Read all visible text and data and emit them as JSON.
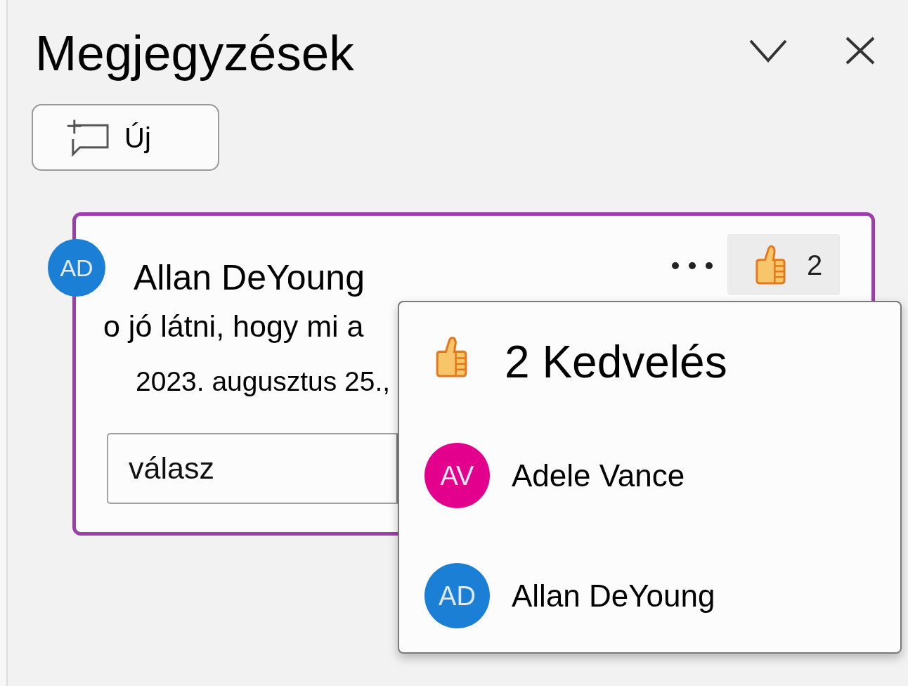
{
  "pane": {
    "title": "Megjegyzések"
  },
  "new_button": {
    "label": "Új"
  },
  "comment": {
    "selected": true,
    "author": {
      "initials": "AD",
      "name": "Allan DeYoung"
    },
    "text": "o jó látni, hogy mi a",
    "date": "2023. augusztus 25.,",
    "likes": {
      "count": "2"
    },
    "reply": {
      "placeholder": "válasz"
    }
  },
  "likes_popup": {
    "title": "2 Kedvelés",
    "people": [
      {
        "initials": "AV",
        "name": "Adele Vance",
        "color": "#e3008c"
      },
      {
        "initials": "AD",
        "name": "Allan DeYoung",
        "color": "#1b7fd6"
      }
    ]
  }
}
